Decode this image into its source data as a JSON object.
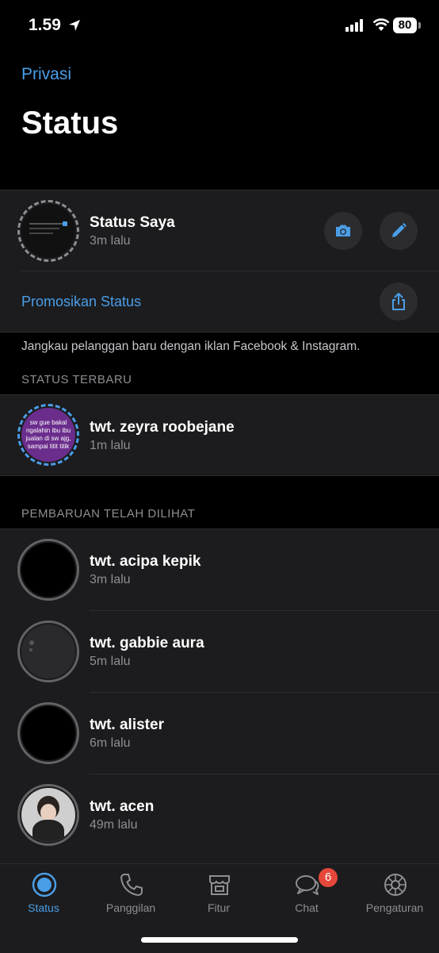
{
  "status_bar": {
    "time": "1.59",
    "battery": "80"
  },
  "nav": {
    "back_label": "Privasi",
    "title": "Status"
  },
  "my_status": {
    "name": "Status Saya",
    "time": "3m lalu",
    "camera_icon": "camera-icon",
    "pencil_icon": "pencil-icon"
  },
  "promo": {
    "label": "Promosikan Status",
    "caption": "Jangkau pelanggan baru dengan iklan Facebook & Instagram.",
    "share_icon": "share-icon"
  },
  "recent": {
    "header": "STATUS TERBARU",
    "items": [
      {
        "name": "twt. zeyra roobejane",
        "time": "1m lalu",
        "thumb_text": "sw gue bakal ngalahin ibu ibu jualan di sw ajg, sampai titit titik"
      }
    ]
  },
  "viewed": {
    "header": "PEMBARUAN TELAH DILIHAT",
    "items": [
      {
        "name": "twt. acipa kepik",
        "time": "3m lalu"
      },
      {
        "name": "twt. gabbie aura",
        "time": "5m lalu"
      },
      {
        "name": "twt. alister",
        "time": "6m lalu"
      },
      {
        "name": "twt. acen",
        "time": "49m lalu"
      }
    ]
  },
  "tabs": [
    {
      "label": "Status",
      "icon": "status-icon",
      "active": true
    },
    {
      "label": "Panggilan",
      "icon": "phone-icon"
    },
    {
      "label": "Fitur",
      "icon": "store-icon"
    },
    {
      "label": "Chat",
      "icon": "chat-icon",
      "badge": "6"
    },
    {
      "label": "Pengaturan",
      "icon": "gear-icon"
    }
  ],
  "colors": {
    "accent": "#4a9ee8",
    "badge": "#e5483a",
    "background": "#000000",
    "cell": "#1c1c1e"
  }
}
